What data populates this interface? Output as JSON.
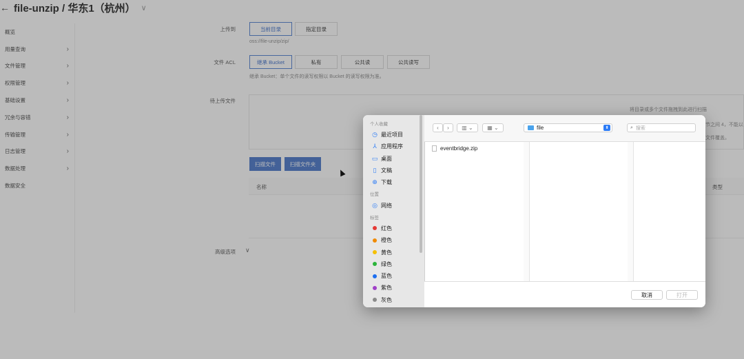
{
  "header": {
    "back_icon": "←",
    "title": "file-unzip / 华东1（杭州）",
    "dropdown_icon": "∨"
  },
  "sidebar": {
    "items": [
      {
        "label": "概览",
        "arrow": ""
      },
      {
        "label": "用量查询",
        "arrow": "›"
      },
      {
        "label": "文件管理",
        "arrow": "›"
      },
      {
        "label": "权限管理",
        "arrow": "›"
      },
      {
        "label": "基础设置",
        "arrow": "›"
      },
      {
        "label": "冗余与容错",
        "arrow": "›"
      },
      {
        "label": "传输管理",
        "arrow": "›"
      },
      {
        "label": "日志管理",
        "arrow": "›"
      },
      {
        "label": "数据处理",
        "arrow": "›"
      },
      {
        "label": "数据安全",
        "arrow": ""
      }
    ]
  },
  "form": {
    "upload_to_label": "上传到",
    "upload_to_options": [
      "当前目录",
      "指定目录"
    ],
    "upload_path": "oss://file-unzip/zip/",
    "acl_label": "文件 ACL",
    "acl_options": [
      "继承 Bucket",
      "私有",
      "公共读",
      "公共读写"
    ],
    "acl_hint": "继承 Bucket：单个文件的读写权限以 Bucket 的读写权限为准。",
    "pending_label": "待上传文件",
    "drop_hint": "将目录或多个文件拖拽到此进行扫描",
    "side_hint_1": "节之间 4，不能以",
    "side_hint_2": "文件覆盖。",
    "scan_files_btn": "扫描文件",
    "scan_folder_btn": "扫描文件夹",
    "table_col_name": "名称",
    "table_col_type": "类型",
    "advanced_label": "高级选项",
    "advanced_icon": "∨"
  },
  "dialog": {
    "sections": [
      {
        "title": "个人收藏",
        "items": [
          {
            "icon": "clock-icon",
            "glyph": "◷",
            "label": "最近项目"
          },
          {
            "icon": "apps-icon",
            "glyph": "⅄",
            "label": "应用程序"
          },
          {
            "icon": "desktop-icon",
            "glyph": "▭",
            "label": "桌面"
          },
          {
            "icon": "document-icon",
            "glyph": "▯",
            "label": "文稿"
          },
          {
            "icon": "download-icon",
            "glyph": "⊕",
            "label": "下载"
          }
        ]
      },
      {
        "title": "位置",
        "items": [
          {
            "icon": "network-icon",
            "glyph": "◎",
            "label": "网络"
          }
        ]
      },
      {
        "title": "标签",
        "tags": [
          {
            "label": "红色",
            "color": "#e53935"
          },
          {
            "label": "橙色",
            "color": "#f08a00"
          },
          {
            "label": "黄色",
            "color": "#f5c000"
          },
          {
            "label": "绿色",
            "color": "#2bb43a"
          },
          {
            "label": "蓝色",
            "color": "#1e6ff0"
          },
          {
            "label": "紫色",
            "color": "#a040c8"
          },
          {
            "label": "灰色",
            "color": "#8a8a8a"
          }
        ]
      }
    ],
    "toolbar": {
      "back": "‹",
      "forward": "›",
      "view_columns": "▥ ⌄",
      "view_grid": "▦ ⌄",
      "path": "file",
      "path_updown": "⬍",
      "search_placeholder": "搜索"
    },
    "files": [
      "eventbridge.zip"
    ],
    "cancel_label": "取消",
    "open_label": "打开"
  }
}
